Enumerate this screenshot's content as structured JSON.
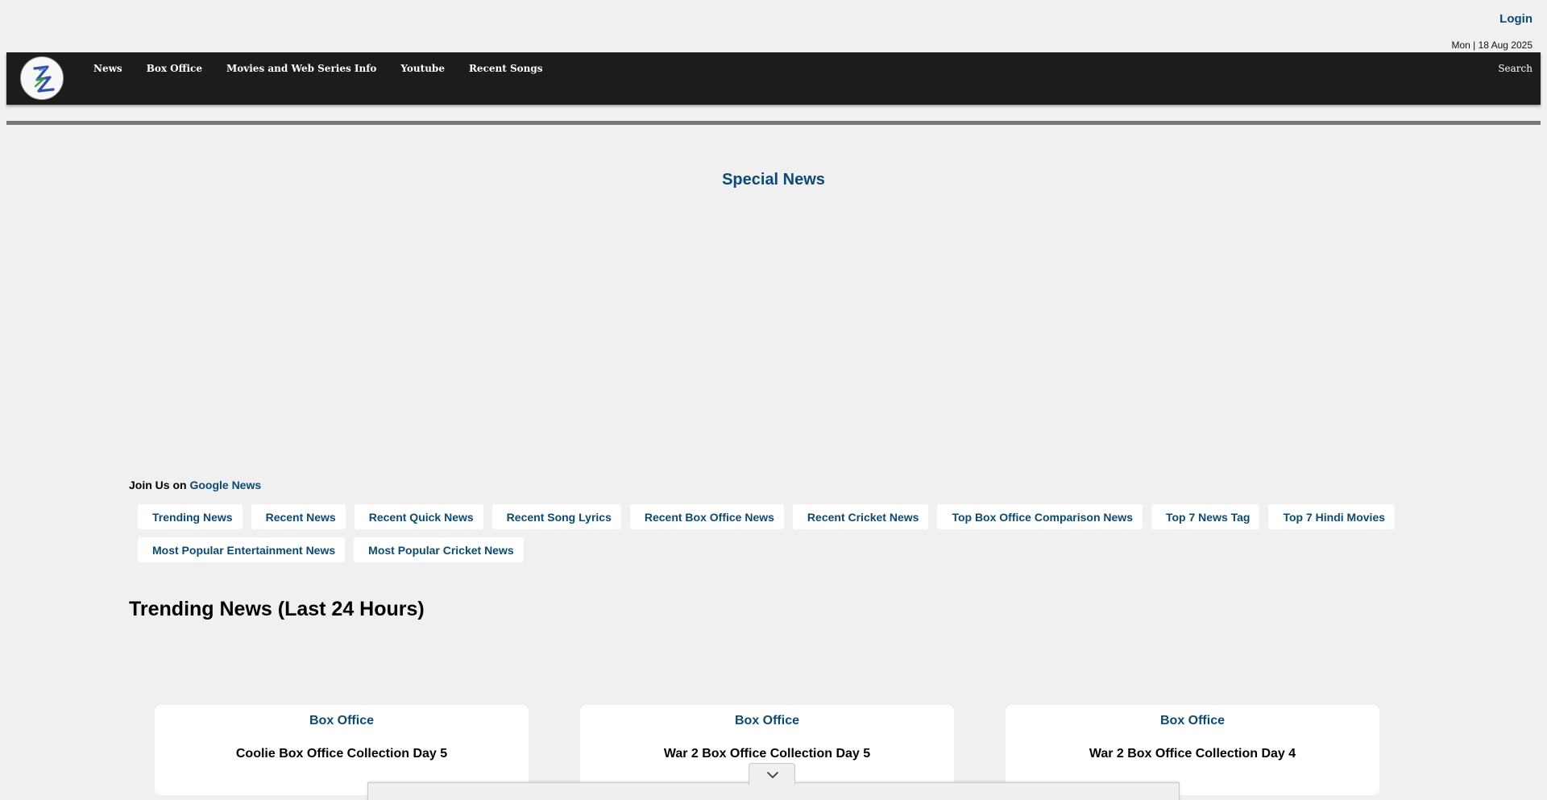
{
  "header": {
    "login_label": "Login",
    "date": "Mon | 18 Aug 2025"
  },
  "nav": {
    "items": [
      {
        "label": "News"
      },
      {
        "label": "Box Office"
      },
      {
        "label": "Movies and Web Series Info"
      },
      {
        "label": "Youtube"
      },
      {
        "label": "Recent Songs"
      }
    ],
    "search_label": "Search"
  },
  "main": {
    "special_heading": "Special News",
    "join_prefix": "Join Us on",
    "join_link": "Google News",
    "quick_links_row1": [
      "Trending News",
      "Recent News",
      "Recent Quick News",
      "Recent Song Lyrics",
      "Recent Box Office News",
      "Recent Cricket News",
      "Top Box Office Comparison News",
      "Top 7 News Tag",
      "Top 7 Hindi Movies"
    ],
    "quick_links_row2": [
      "Most Popular Entertainment News",
      "Most Popular Cricket News"
    ],
    "trending_heading": "Trending News (Last 24 Hours)",
    "cards": [
      {
        "category": "Box Office",
        "title": "Coolie Box Office Collection Day 5"
      },
      {
        "category": "Box Office",
        "title": "War 2 Box Office Collection Day 5"
      },
      {
        "category": "Box Office",
        "title": "War 2 Box Office Collection Day 4"
      }
    ]
  },
  "colors": {
    "accent": "#0b4a75",
    "navbar": "#1c1c1c",
    "background": "#f0f0f0"
  },
  "icons": {
    "logo": "zigzag-logo-icon",
    "collapse": "chevron-down-icon"
  }
}
